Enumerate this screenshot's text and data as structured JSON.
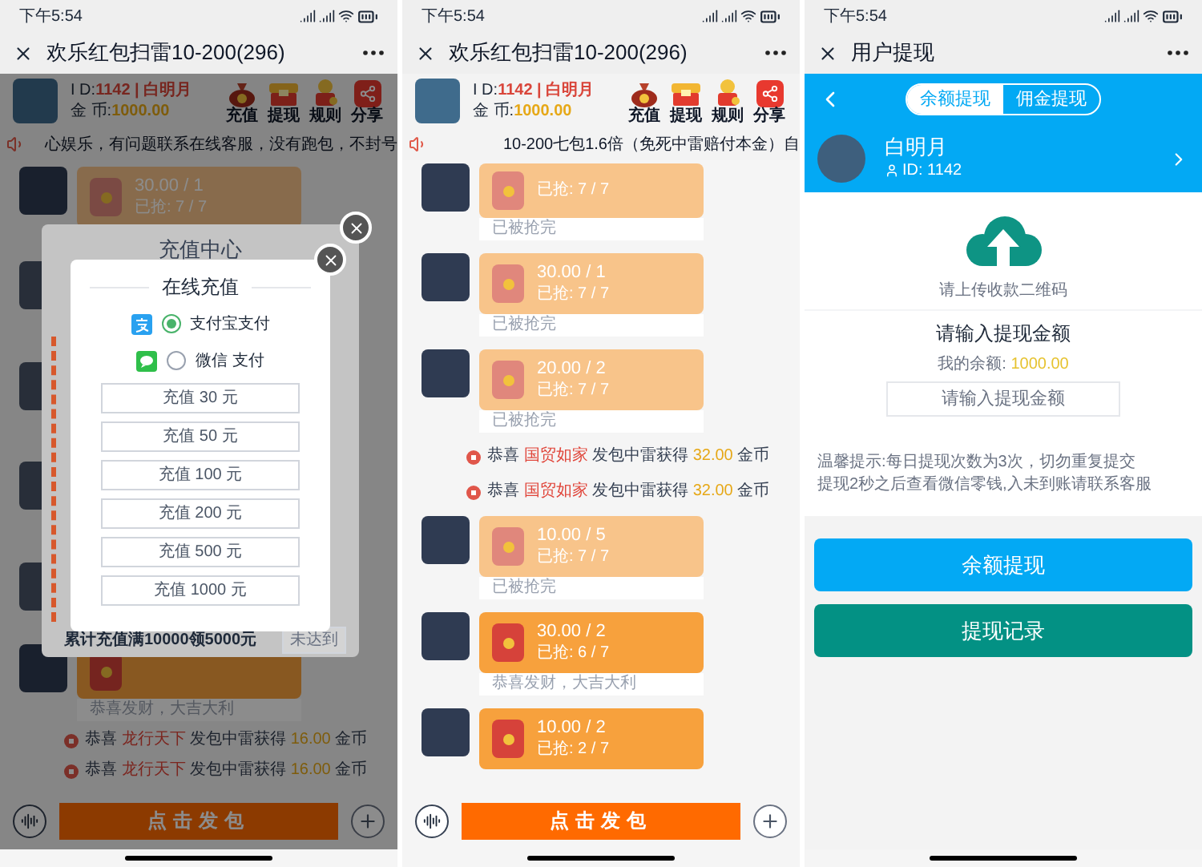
{
  "screens": [
    {
      "kind": "game",
      "status_bar": {
        "time": "下午5:54"
      },
      "title": "欢乐红包扫雷10-200(296)",
      "user": {
        "id_label": "I D:",
        "id_value": "1142 | 白明月",
        "coins_label": "金 币:",
        "coins_value": "1000.00"
      },
      "actions": [
        {
          "kind": "bag",
          "label": "充值"
        },
        {
          "kind": "chest",
          "label": "提现"
        },
        {
          "kind": "figure",
          "label": "规则"
        },
        {
          "kind": "share",
          "label": "分享"
        }
      ],
      "marquee": "心娱乐，有问题联系在线客服，没有跑包，不封号",
      "messages": [
        {
          "kind": "packet",
          "amount": "30.00 / 1",
          "grabbed": "已抢: 7 / 7",
          "finished": true
        },
        {
          "kind": "packet",
          "footer": "恭喜发财，大吉大利",
          "finished": false
        },
        {
          "kind": "notice",
          "prefix": "恭喜",
          "name": "龙行天下",
          "action": "发包中雷获得",
          "amount": "16.00",
          "unit": "金币"
        },
        {
          "kind": "notice",
          "prefix": "恭喜",
          "name": "龙行天下",
          "action": "发包中雷获得",
          "amount": "16.00",
          "unit": "金币"
        }
      ],
      "send_button": "点击发包",
      "dialog": {
        "back_title": "充值中心",
        "title": "在线充值",
        "payment_methods": [
          {
            "kind": "alipay",
            "label": "支付宝支付",
            "selected": true
          },
          {
            "kind": "wechat",
            "label": "微信 支付",
            "selected": false
          }
        ],
        "amounts": [
          "充值 30 元",
          "充值 50 元",
          "充值 100 元",
          "充值 200 元",
          "充值 500 元",
          "充值 1000 元"
        ],
        "promo": "累计充值满10000领5000元",
        "promo_button": "未达到"
      }
    },
    {
      "kind": "game",
      "status_bar": {
        "time": "下午5:54"
      },
      "title": "欢乐红包扫雷10-200(296)",
      "user": {
        "id_label": "I D:",
        "id_value": "1142 | 白明月",
        "coins_label": "金 币:",
        "coins_value": "1000.00"
      },
      "actions": [
        {
          "kind": "bag",
          "label": "充值"
        },
        {
          "kind": "chest",
          "label": "提现"
        },
        {
          "kind": "figure",
          "label": "规则"
        },
        {
          "kind": "share",
          "label": "分享"
        }
      ],
      "marquee": "10-200七包1.6倍（免死中雷赔付本金）自",
      "messages": [
        {
          "kind": "packet",
          "grabbed": "已抢: 7 / 7",
          "footer": "已被抢完",
          "finished": true
        },
        {
          "kind": "packet",
          "amount": "30.00 / 1",
          "grabbed": "已抢: 7 / 7",
          "footer": "已被抢完",
          "finished": true
        },
        {
          "kind": "packet",
          "amount": "20.00 / 2",
          "grabbed": "已抢: 7 / 7",
          "footer": "已被抢完",
          "finished": true
        },
        {
          "kind": "notice",
          "prefix": "恭喜",
          "name": "国贸如家",
          "action": "发包中雷获得",
          "amount": "32.00",
          "unit": "金币"
        },
        {
          "kind": "notice",
          "prefix": "恭喜",
          "name": "国贸如家",
          "action": "发包中雷获得",
          "amount": "32.00",
          "unit": "金币"
        },
        {
          "kind": "packet",
          "amount": "10.00 / 5",
          "grabbed": "已抢: 7 / 7",
          "footer": "已被抢完",
          "finished": true
        },
        {
          "kind": "packet",
          "amount": "30.00 / 2",
          "grabbed": "已抢: 6 / 7",
          "footer": "恭喜发财，大吉大利",
          "finished": false
        },
        {
          "kind": "packet",
          "amount": "10.00 / 2",
          "grabbed": "已抢: 2 / 7",
          "finished": false
        }
      ],
      "send_button": "点击发包"
    },
    {
      "kind": "withdraw",
      "status_bar": {
        "time": "下午5:54"
      },
      "title": "用户提现",
      "tabs": [
        {
          "label": "余额提现",
          "selected": true
        },
        {
          "label": "佣金提现",
          "selected": false
        }
      ],
      "profile": {
        "name": "白明月",
        "id": "ID: 1142"
      },
      "upload_hint": "请上传收款二维码",
      "amount_title": "请输入提现金额",
      "balance_label": "我的余额:",
      "balance_value": "1000.00",
      "amount_field": {
        "placeholder": "请输入提现金额"
      },
      "tips": [
        "温馨提示:每日提现次数为3次，切勿重复提交",
        "提现2秒之后查看微信零钱,入未到账请联系客服"
      ],
      "buttons": [
        {
          "kind": "primary",
          "label": "余额提现"
        },
        {
          "kind": "secondary",
          "label": "提现记录"
        }
      ]
    }
  ]
}
